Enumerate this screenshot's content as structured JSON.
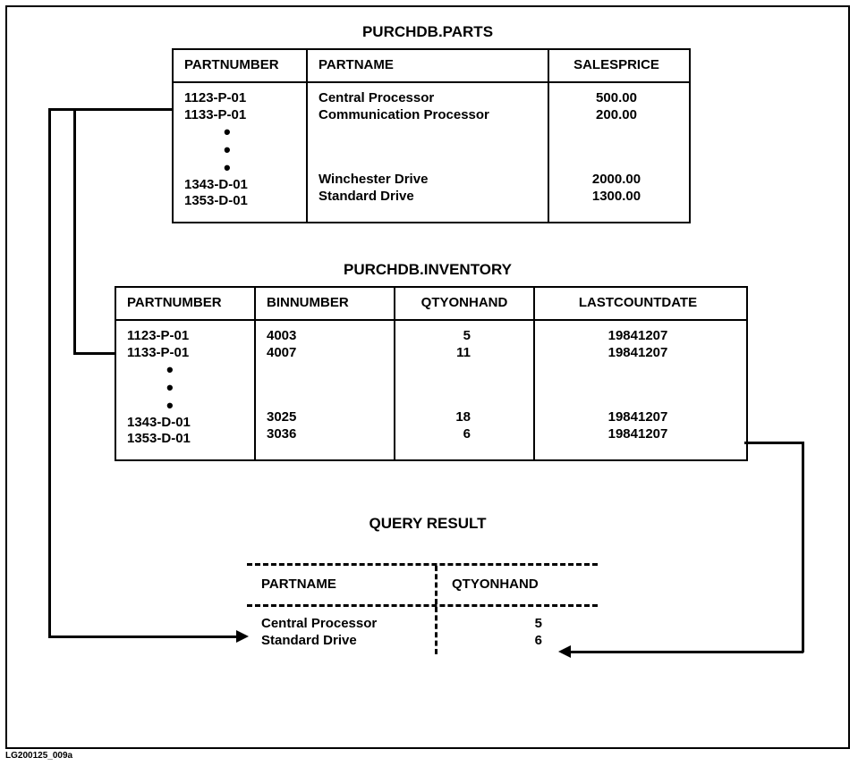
{
  "footer": "LG200125_009a",
  "titles": {
    "parts": "PURCHDB.PARTS",
    "inventory": "PURCHDB.INVENTORY",
    "query": "QUERY RESULT"
  },
  "parts": {
    "headers": {
      "c1": "PARTNUMBER",
      "c2": "PARTNAME",
      "c3": "SALESPRICE"
    },
    "r1": {
      "c1": "1123-P-01",
      "c2": "Central Processor",
      "c3": "500.00"
    },
    "r2": {
      "c1": "1133-P-01",
      "c2": "Communication Processor",
      "c3": "200.00"
    },
    "r3": {
      "c1": "1343-D-01",
      "c2": "Winchester  Drive",
      "c3": "2000.00"
    },
    "r4": {
      "c1": "1353-D-01",
      "c2": "Standard Drive",
      "c3": "1300.00"
    }
  },
  "inventory": {
    "headers": {
      "c1": "PARTNUMBER",
      "c2": "BINNUMBER",
      "c3": "QTYONHAND",
      "c4": "LASTCOUNTDATE"
    },
    "r1": {
      "c1": "1123-P-01",
      "c2": "4003",
      "c3": "5",
      "c4": "19841207"
    },
    "r2": {
      "c1": "1133-P-01",
      "c2": "4007",
      "c3": "11",
      "c4": "19841207"
    },
    "r3": {
      "c1": "1343-D-01",
      "c2": "3025",
      "c3": "18",
      "c4": "19841207"
    },
    "r4": {
      "c1": "1353-D-01",
      "c2": "3036",
      "c3": "6",
      "c4": "19841207"
    }
  },
  "query": {
    "headers": {
      "c1": "PARTNAME",
      "c2": "QTYONHAND"
    },
    "r1": {
      "c1": "Central Processor",
      "c2": "5"
    },
    "r2": {
      "c1": "Standard Drive",
      "c2": "6"
    }
  }
}
